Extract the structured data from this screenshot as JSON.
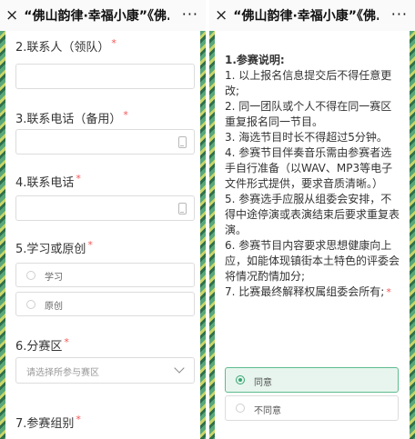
{
  "app": {
    "close_glyph": "×",
    "title": "“佛山韵律·幸福小康”《佛...",
    "more_glyph": "···"
  },
  "left_form": {
    "q2": {
      "label": "2.联系人（领队）",
      "required": "*"
    },
    "q3": {
      "label": "3.联系电话（备用）",
      "required": "*"
    },
    "q4": {
      "label": "4.联系电话",
      "required": "*"
    },
    "q5": {
      "label": "5.学习或原创",
      "required": "*",
      "options": [
        "学习",
        "原创"
      ]
    },
    "q6": {
      "label": "6.分赛区",
      "required": "*",
      "placeholder": "请选择所参与赛区"
    },
    "q7": {
      "label": "7.参赛组别",
      "required": "*"
    }
  },
  "right_form": {
    "notes_title": "1.参赛说明:",
    "notes": [
      "1. 以上报名信息提交后不得任意更改;",
      "2. 同一团队或个人不得在同一赛区重复报名同一节目。",
      "3. 海选节目时长不得超过5分钟。",
      "4. 参赛节目伴奏音乐需由参赛者选手自行准备（以WAV、MP3等电子文件形式提供，要求音质清晰。）",
      "5. 参赛选手应服从组委会安排，不得中途停演或表演结束后要求重复表演。",
      "6. 参赛节目内容要求思想健康向上应，如能体现镇街本土特色的评委会将情况酌情加分;",
      "7. 比赛最终解释权属组委会所有;"
    ],
    "required": "*",
    "choices": [
      "同意",
      "不同意"
    ],
    "selected_index": 0
  },
  "colors": {
    "accent": "#36a771",
    "selected_bg": "#e7f5ee",
    "required": "#f25555"
  }
}
